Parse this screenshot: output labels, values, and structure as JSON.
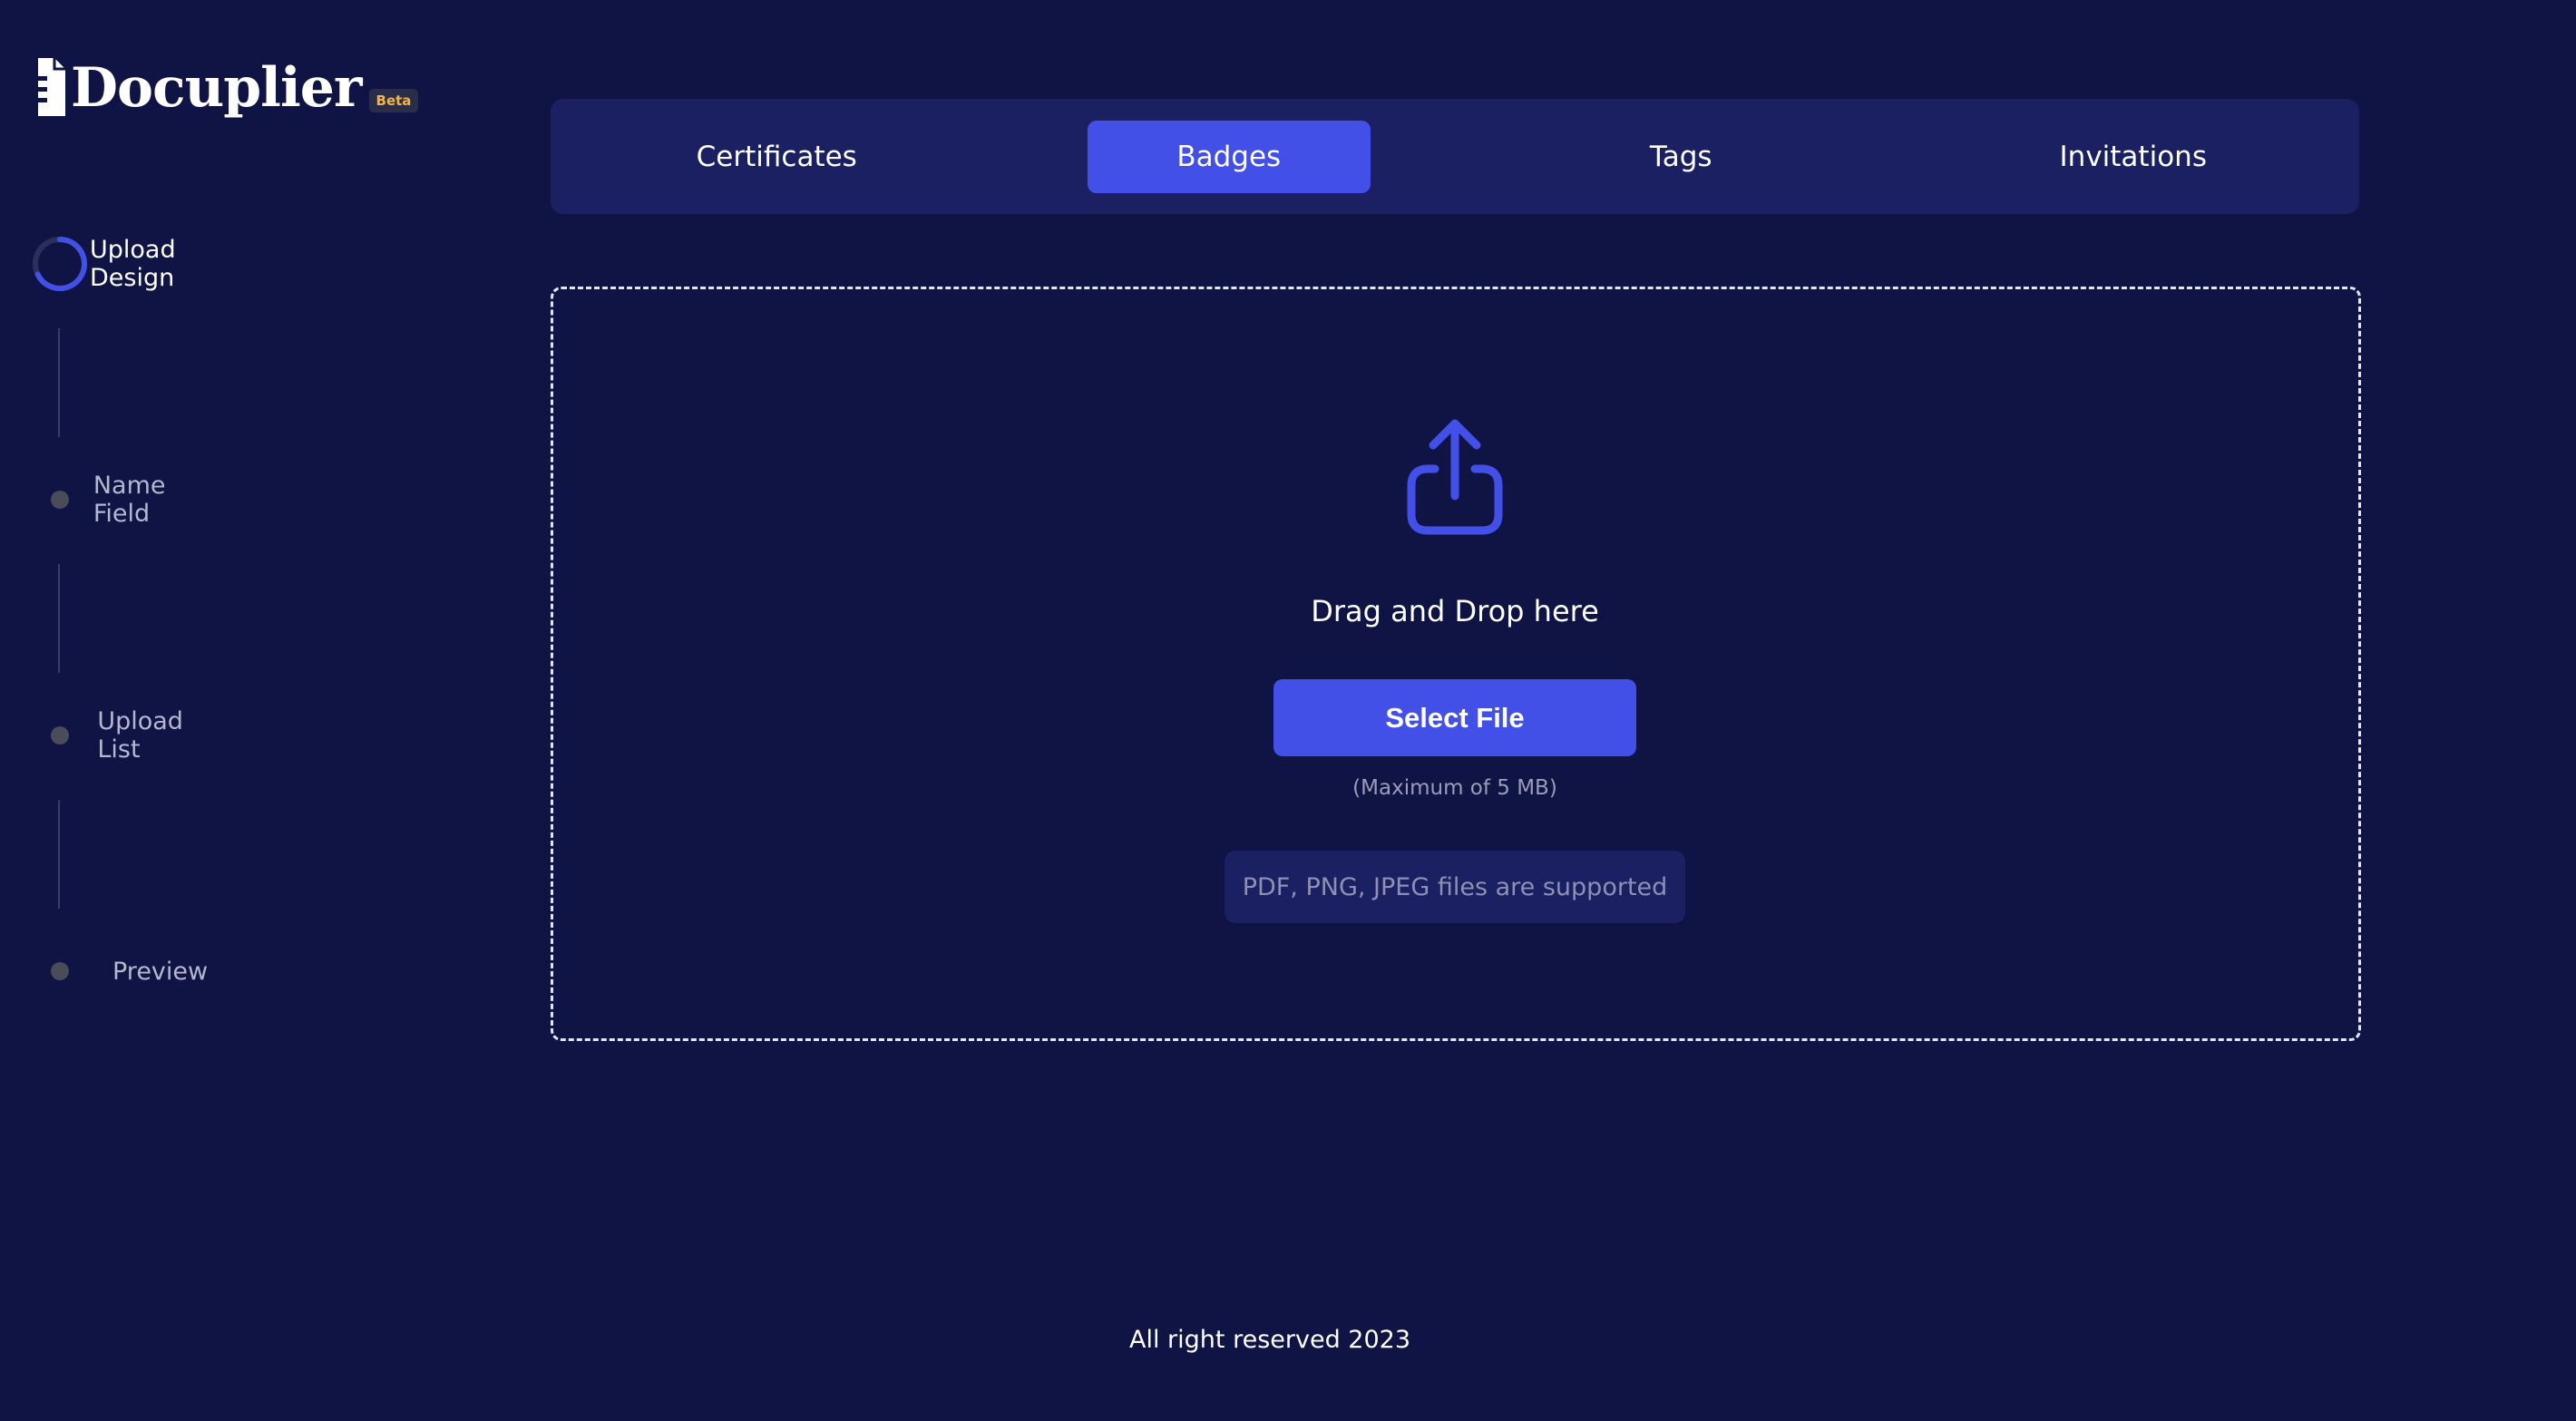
{
  "app": {
    "name": "Docuplier",
    "badge": "Beta"
  },
  "steps": [
    {
      "label": "Upload Design",
      "state": "active"
    },
    {
      "label": "Name Field",
      "state": "pending"
    },
    {
      "label": "Upload List",
      "state": "pending"
    },
    {
      "label": "Preview",
      "state": "pending"
    }
  ],
  "tabs": [
    {
      "label": "Certificates",
      "active": false
    },
    {
      "label": "Badges",
      "active": true
    },
    {
      "label": "Tags",
      "active": false
    },
    {
      "label": "Invitations",
      "active": false
    }
  ],
  "dropzone": {
    "icon": "upload-share-icon",
    "prompt": "Drag and Drop here",
    "button_label": "Select File",
    "size_note": "(Maximum of 5 MB)",
    "supported_note": "PDF, PNG, JPEG files are supported"
  },
  "footer": {
    "text": "All right reserved 2023"
  },
  "colors": {
    "background": "#101444",
    "panel": "#1b2062",
    "accent": "#4350e8",
    "badge_text": "#f0b54a",
    "inactive_dot": "#4a4c5a"
  }
}
